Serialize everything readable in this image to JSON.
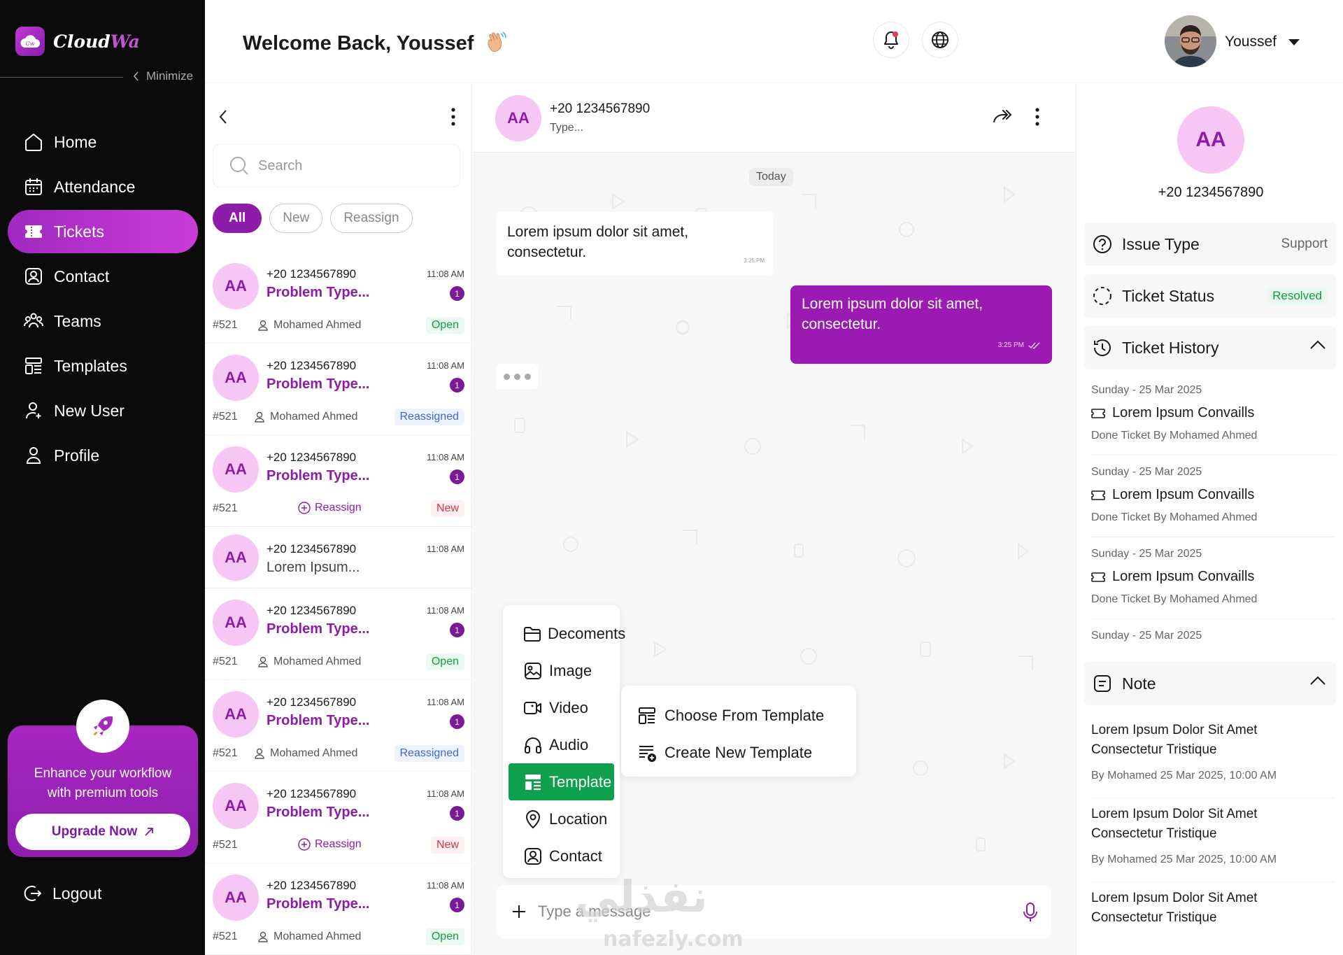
{
  "brand": {
    "name_main": "Cloud",
    "name_accent": "Wa",
    "logo_glyph": "Cw",
    "accent": "#8d1ca8"
  },
  "sidebar": {
    "minimize_label": "Minimize",
    "items": [
      {
        "label": "Home",
        "icon": "home-icon",
        "active": false
      },
      {
        "label": "Attendance",
        "icon": "calendar-icon",
        "active": false
      },
      {
        "label": "Tickets",
        "icon": "ticket-icon",
        "active": true
      },
      {
        "label": "Contact",
        "icon": "contact-icon",
        "active": false
      },
      {
        "label": "Teams",
        "icon": "teams-icon",
        "active": false
      },
      {
        "label": "Templates",
        "icon": "templates-icon",
        "active": false
      },
      {
        "label": "New User",
        "icon": "new-user-icon",
        "active": false
      },
      {
        "label": "Profile",
        "icon": "profile-icon",
        "active": false
      }
    ],
    "promo": {
      "text_line1": "Enhance your workflow",
      "text_line2": "with premium tools",
      "button": "Upgrade Now"
    },
    "logout": "Logout"
  },
  "header": {
    "welcome": "Welcome Back, Youssef",
    "user_name": "Youssef"
  },
  "ticket_list": {
    "search_placeholder": "Search",
    "filters": [
      "All",
      "New",
      "Reassign"
    ],
    "tickets": [
      {
        "initials": "AA",
        "phone": "+20 1234567890",
        "time": "11:08 AM",
        "subject": "Problem Type...",
        "badge": "1",
        "id": "#521",
        "agent": "Mohamed Ahmed",
        "status": "Open"
      },
      {
        "initials": "AA",
        "phone": "+20 1234567890",
        "time": "11:08 AM",
        "subject": "Problem Type...",
        "badge": "1",
        "id": "#521",
        "agent": "Mohamed Ahmed",
        "status": "Reassigned"
      },
      {
        "initials": "AA",
        "phone": "+20 1234567890",
        "time": "11:08 AM",
        "subject": "Problem Type...",
        "badge": "1",
        "id": "#521",
        "reassign": "Reassign",
        "status": "New"
      },
      {
        "initials": "AA",
        "phone": "+20 1234567890",
        "time": "11:08 AM",
        "subject": "Lorem Ipsum..."
      },
      {
        "initials": "AA",
        "phone": "+20 1234567890",
        "time": "11:08 AM",
        "subject": "Problem Type...",
        "badge": "1",
        "id": "#521",
        "agent": "Mohamed Ahmed",
        "status": "Open"
      },
      {
        "initials": "AA",
        "phone": "+20 1234567890",
        "time": "11:08 AM",
        "subject": "Problem Type...",
        "badge": "1",
        "id": "#521",
        "agent": "Mohamed Ahmed",
        "status": "Reassigned"
      },
      {
        "initials": "AA",
        "phone": "+20 1234567890",
        "time": "11:08 AM",
        "subject": "Problem Type...",
        "badge": "1",
        "id": "#521",
        "reassign": "Reassign",
        "status": "New"
      },
      {
        "initials": "AA",
        "phone": "+20 1234567890",
        "time": "11:08 AM",
        "subject": "Problem Type...",
        "badge": "1",
        "id": "#521",
        "agent": "Mohamed Ahmed",
        "status": "Open"
      }
    ]
  },
  "chat": {
    "contact_initials": "AA",
    "contact_phone": "+20 1234567890",
    "contact_status": "Type...",
    "date_divider": "Today",
    "incoming": {
      "line1": "Lorem ipsum dolor sit amet,",
      "line2": "consectetur.",
      "time": "3:25 PM"
    },
    "outgoing": {
      "line1": "Lorem ipsum dolor sit amet,",
      "line2": "consectetur.",
      "time": "3:25 PM"
    },
    "attach_menu": [
      {
        "label": "Decoments",
        "icon": "documents-icon"
      },
      {
        "label": "Image",
        "icon": "image-icon"
      },
      {
        "label": "Video",
        "icon": "video-icon"
      },
      {
        "label": "Audio",
        "icon": "audio-icon"
      },
      {
        "label": "Template",
        "icon": "template-icon",
        "active": true
      },
      {
        "label": "Location",
        "icon": "location-icon"
      },
      {
        "label": "Contact",
        "icon": "contact-icon"
      }
    ],
    "template_menu": [
      {
        "label": "Choose From Template",
        "icon": "choose-template-icon"
      },
      {
        "label": "Create New Template",
        "icon": "create-template-icon"
      }
    ],
    "composer_placeholder": "Type a message",
    "watermark_ar": "نفذلي",
    "watermark_en": "nafezly.com"
  },
  "details": {
    "initials": "AA",
    "phone": "+20 1234567890",
    "issue_type_label": "Issue Type",
    "issue_type_value": "Support",
    "ticket_status_label": "Ticket Status",
    "ticket_status_value": "Resolved",
    "history_label": "Ticket History",
    "history": [
      {
        "date": "Sunday - 25 Mar 2025",
        "title": "Lorem Ipsum Convaills",
        "by": "Done Ticket By Mohamed Ahmed"
      },
      {
        "date": "Sunday - 25 Mar 2025",
        "title": "Lorem Ipsum Convaills",
        "by": "Done Ticket By Mohamed Ahmed"
      },
      {
        "date": "Sunday - 25 Mar 2025",
        "title": "Lorem Ipsum Convaills",
        "by": "Done Ticket By Mohamed Ahmed"
      },
      {
        "date": "Sunday - 25 Mar 2025"
      }
    ],
    "note_label": "Note",
    "notes": [
      {
        "line1": "Lorem Ipsum Dolor Sit Amet",
        "line2": "Consectetur Tristique",
        "by": "By Mohamed 25 Mar 2025, 10:00 AM"
      },
      {
        "line1": "Lorem Ipsum Dolor Sit Amet",
        "line2": "Consectetur Tristique",
        "by": "By Mohamed 25 Mar 2025, 10:00 AM"
      },
      {
        "line1": "Lorem Ipsum Dolor Sit Amet",
        "line2": "Consectetur Tristique"
      }
    ]
  }
}
